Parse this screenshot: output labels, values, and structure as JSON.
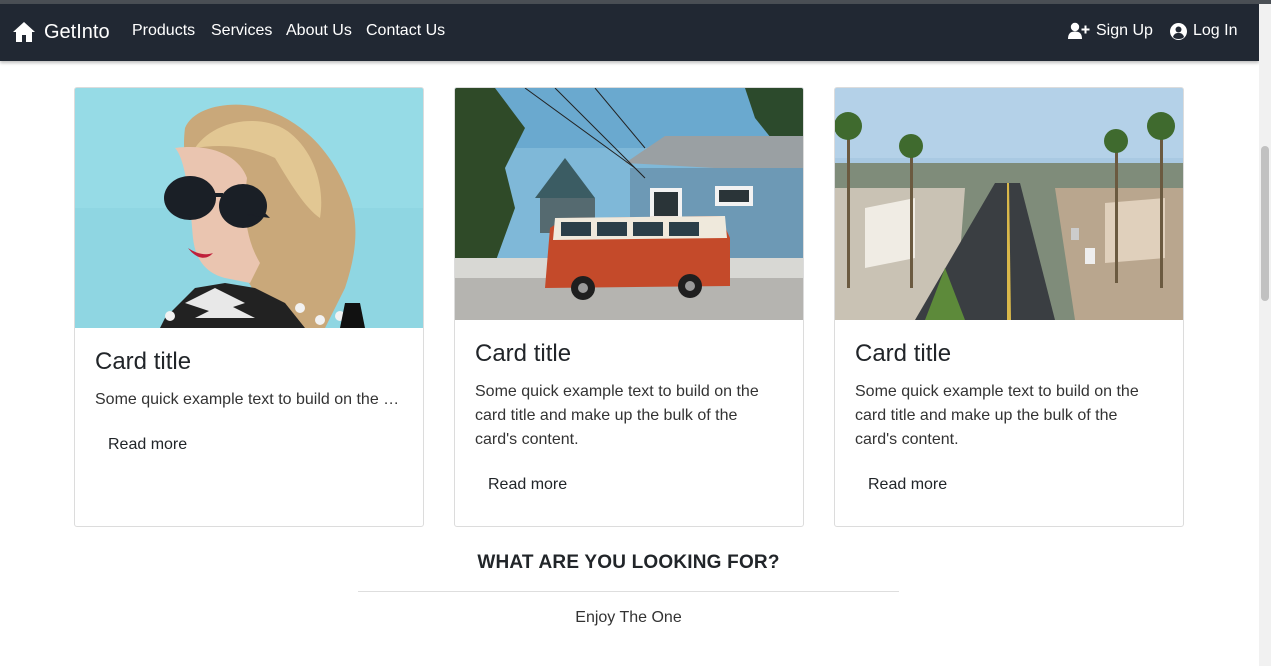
{
  "navbar": {
    "brand": "GetInto",
    "links": [
      "Products",
      "Services",
      "About Us",
      "Contact Us"
    ],
    "signup": "Sign Up",
    "login": "Log In",
    "icons": {
      "brand": "home-icon",
      "signup": "user-plus-icon",
      "login": "user-circle-icon"
    },
    "colors": {
      "background": "#212833",
      "text": "#ffffff"
    }
  },
  "cards": [
    {
      "title": "Card title",
      "text": "Some quick example text to build on the card title and make up the bulk of the card's content.",
      "button": "Read more",
      "image": "woman-with-sunglasses-photo"
    },
    {
      "title": "Card title",
      "text": "Some quick example text to build on the card title and make up the bulk of the card's content.",
      "button": "Read more",
      "image": "red-van-and-house-photo"
    },
    {
      "title": "Card title",
      "text": "Some quick example text to build on the card title and make up the bulk of the card's content.",
      "button": "Read more",
      "image": "palm-tree-street-photo"
    }
  ],
  "section": {
    "heading": "WHAT ARE YOU LOOKING FOR?",
    "subtitle": "Enjoy The One"
  }
}
